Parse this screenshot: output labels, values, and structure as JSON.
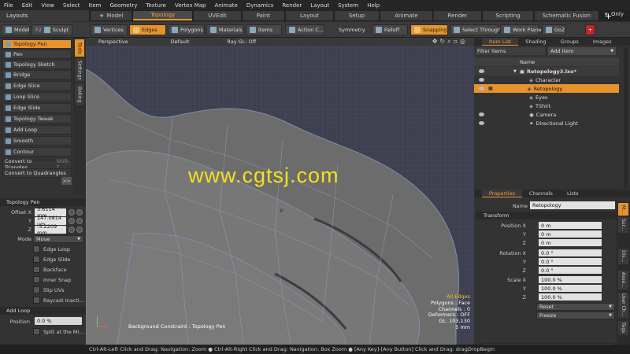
{
  "menu": [
    "File",
    "Edit",
    "View",
    "Select",
    "Item",
    "Geometry",
    "Texture",
    "Vertex Map",
    "Animate",
    "Dynamics",
    "Render",
    "Layout",
    "System",
    "Help"
  ],
  "layout_bar": {
    "layouts_label": "Layouts",
    "tabs": [
      "Model",
      "Topology",
      "UVEdit",
      "Paint",
      "Layout",
      "Setup",
      "Animate",
      "Render",
      "Scripting",
      "Schematic Fusion"
    ],
    "active_tab": "Topology",
    "only_label": "Only"
  },
  "toolbar": {
    "model": "Model",
    "f2": "F2",
    "sculpt": "Sculpt",
    "vertices": "Vertices",
    "edges": "Edges",
    "polygons": "Polygons",
    "materials": "Materials",
    "items": "Items",
    "action_center": "Action C...",
    "symmetry": "Symmetry",
    "falloff": "Falloff",
    "snapping": "Snapping",
    "select_through": "Select Through",
    "work_plane": "Work Plane",
    "goz": "GoZ"
  },
  "tools": [
    "Topology Pen",
    "Pen",
    "Topology Sketch",
    "Bridge",
    "Edge Slice",
    "Loop Slice",
    "Edge Slide",
    "Topology Tweak",
    "Add Loop",
    "Smooth",
    "Contour"
  ],
  "active_tool": "Topology Pen",
  "convert": {
    "triangles": "Convert to Triangles",
    "triangles_shortcut": "Shift-T",
    "quadrangles": "Convert to Quadrangles"
  },
  "side_tabs": [
    "Tools",
    "Settings",
    "Baking"
  ],
  "topology_pen_props": {
    "section": "Topology Pen",
    "offset_x_label": "Offset X",
    "offset_x": "3.6114 mm",
    "y_label": "Y",
    "y": "147.0814 um",
    "z_label": "Z",
    "z": "-3.2209 mm",
    "mode_label": "Mode",
    "mode": "Move",
    "checkboxes": [
      "Edge Loop",
      "Edge Slide",
      "Backface",
      "Inner Snap",
      "Slip UVs",
      "Raycast Inacti..."
    ],
    "add_loop_section": "Add Loop",
    "position_label": "Position",
    "position": "0.0 %",
    "split_label": "Split at the Mi..."
  },
  "viewport": {
    "view": "Perspective",
    "style": "Default",
    "raygl": "Ray GL: Off",
    "watermark": "www.cgtsj.com",
    "background_constraint": "Background Constraint  : Topology Pen",
    "info": [
      "All Edges",
      "Polygons : Face",
      "Channels : 0",
      "Deformers : OFF",
      "GL: 103,130",
      "5 mm"
    ]
  },
  "status_bar": "Ctrl-Alt-Left Click and Drag: Navigation: Zoom ● Ctrl-Alt-Right Click and Drag: Navigation: Box Zoom ● [Any Key]-[Any Button] Click and Drag: dragDropBegin",
  "item_list": {
    "tabs": [
      "Item List",
      "Shading",
      "Groups",
      "Images"
    ],
    "filter_label": "Filter Items",
    "add_item": "Add Item",
    "name_header": "Name",
    "items": [
      {
        "name": "Retopology3.lxo*",
        "level": 0,
        "selected": false
      },
      {
        "name": "Character",
        "level": 1,
        "selected": false
      },
      {
        "name": "Retopology",
        "level": 1,
        "selected": true
      },
      {
        "name": "Eyes",
        "level": 1,
        "selected": false
      },
      {
        "name": "TShirt",
        "level": 1,
        "selected": false
      },
      {
        "name": "Camera",
        "level": 1,
        "selected": false
      },
      {
        "name": "Directional Light",
        "level": 1,
        "selected": false
      }
    ]
  },
  "properties": {
    "tabs": [
      "Properties",
      "Channels",
      "Lists"
    ],
    "name_label": "Name",
    "name_value": "Retopology",
    "transform_section": "Transform",
    "position_x_label": "Position X",
    "y_label": "Y",
    "z_label": "Z",
    "rotation_x_label": "Rotation X",
    "scale_x_label": "Scale X",
    "pos": [
      "0 m",
      "0 m",
      "0 m"
    ],
    "rot": [
      "0.0 °",
      "0.0 °",
      "0.0 °"
    ],
    "scale": [
      "100.0 %",
      "100.0 %",
      "100.0 %"
    ],
    "reset": "Reset",
    "freeze": "Freeze"
  },
  "right_side_tabs": [
    "M...",
    "Sur...",
    "Dis...",
    "Asse...",
    "User Ch...",
    "Tags"
  ],
  "colors": {
    "accent": "#e8922c",
    "watermark": "#f2e21a",
    "selected_row": "#e8922c"
  }
}
